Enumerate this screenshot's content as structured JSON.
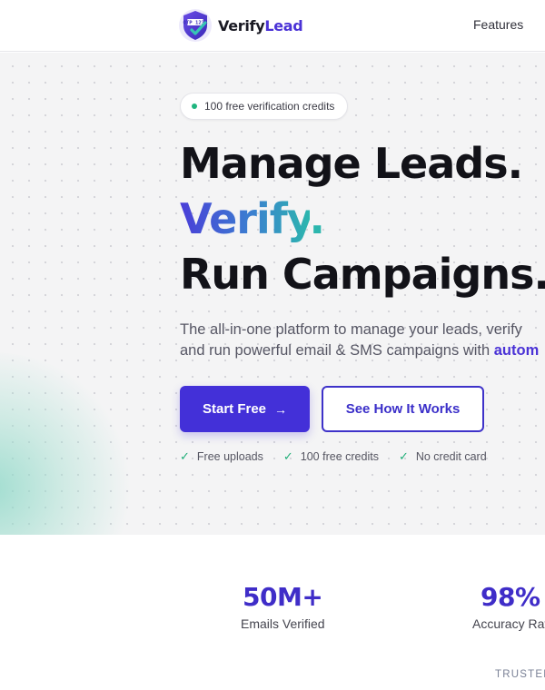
{
  "header": {
    "logo_badge": "OTP 1234",
    "logo_text_a": "Verify",
    "logo_text_b": "Lead",
    "nav": [
      {
        "label": "Features"
      }
    ]
  },
  "hero": {
    "pill_text": "100 free verification credits",
    "headline_line1": "Manage Leads.",
    "headline_line2_word": "Verify",
    "headline_line2_dot": ".",
    "headline_line3": "Run Campaigns.",
    "subtitle_line1": "The all-in-one platform to manage your leads, verify",
    "subtitle_line2": "and run powerful email & SMS campaigns with ",
    "subtitle_accent": "autom",
    "primary_button": "Start Free",
    "primary_button_icon": "→",
    "secondary_button": "See How It Works",
    "checks": [
      {
        "label": "Free uploads",
        "icon": "✓"
      },
      {
        "label": "100 free credits",
        "icon": "✓"
      },
      {
        "label": "No credit card",
        "icon": "✓"
      }
    ]
  },
  "stats": {
    "items": [
      {
        "value": "50M+",
        "label": "Emails Verified"
      },
      {
        "value": "98%",
        "label": "Accuracy Rat"
      }
    ],
    "trusted_label": "TRUSTED"
  },
  "colors": {
    "brand": "#4330d8",
    "accent_teal": "#2cb6ae",
    "check_green": "#1fae78",
    "hero_bg": "#f4f4f5"
  },
  "icons": {
    "logo": "shield-check-icon",
    "pill": "status-dot-icon",
    "primary_button": "arrow-right-icon",
    "checks": "check-icon"
  }
}
